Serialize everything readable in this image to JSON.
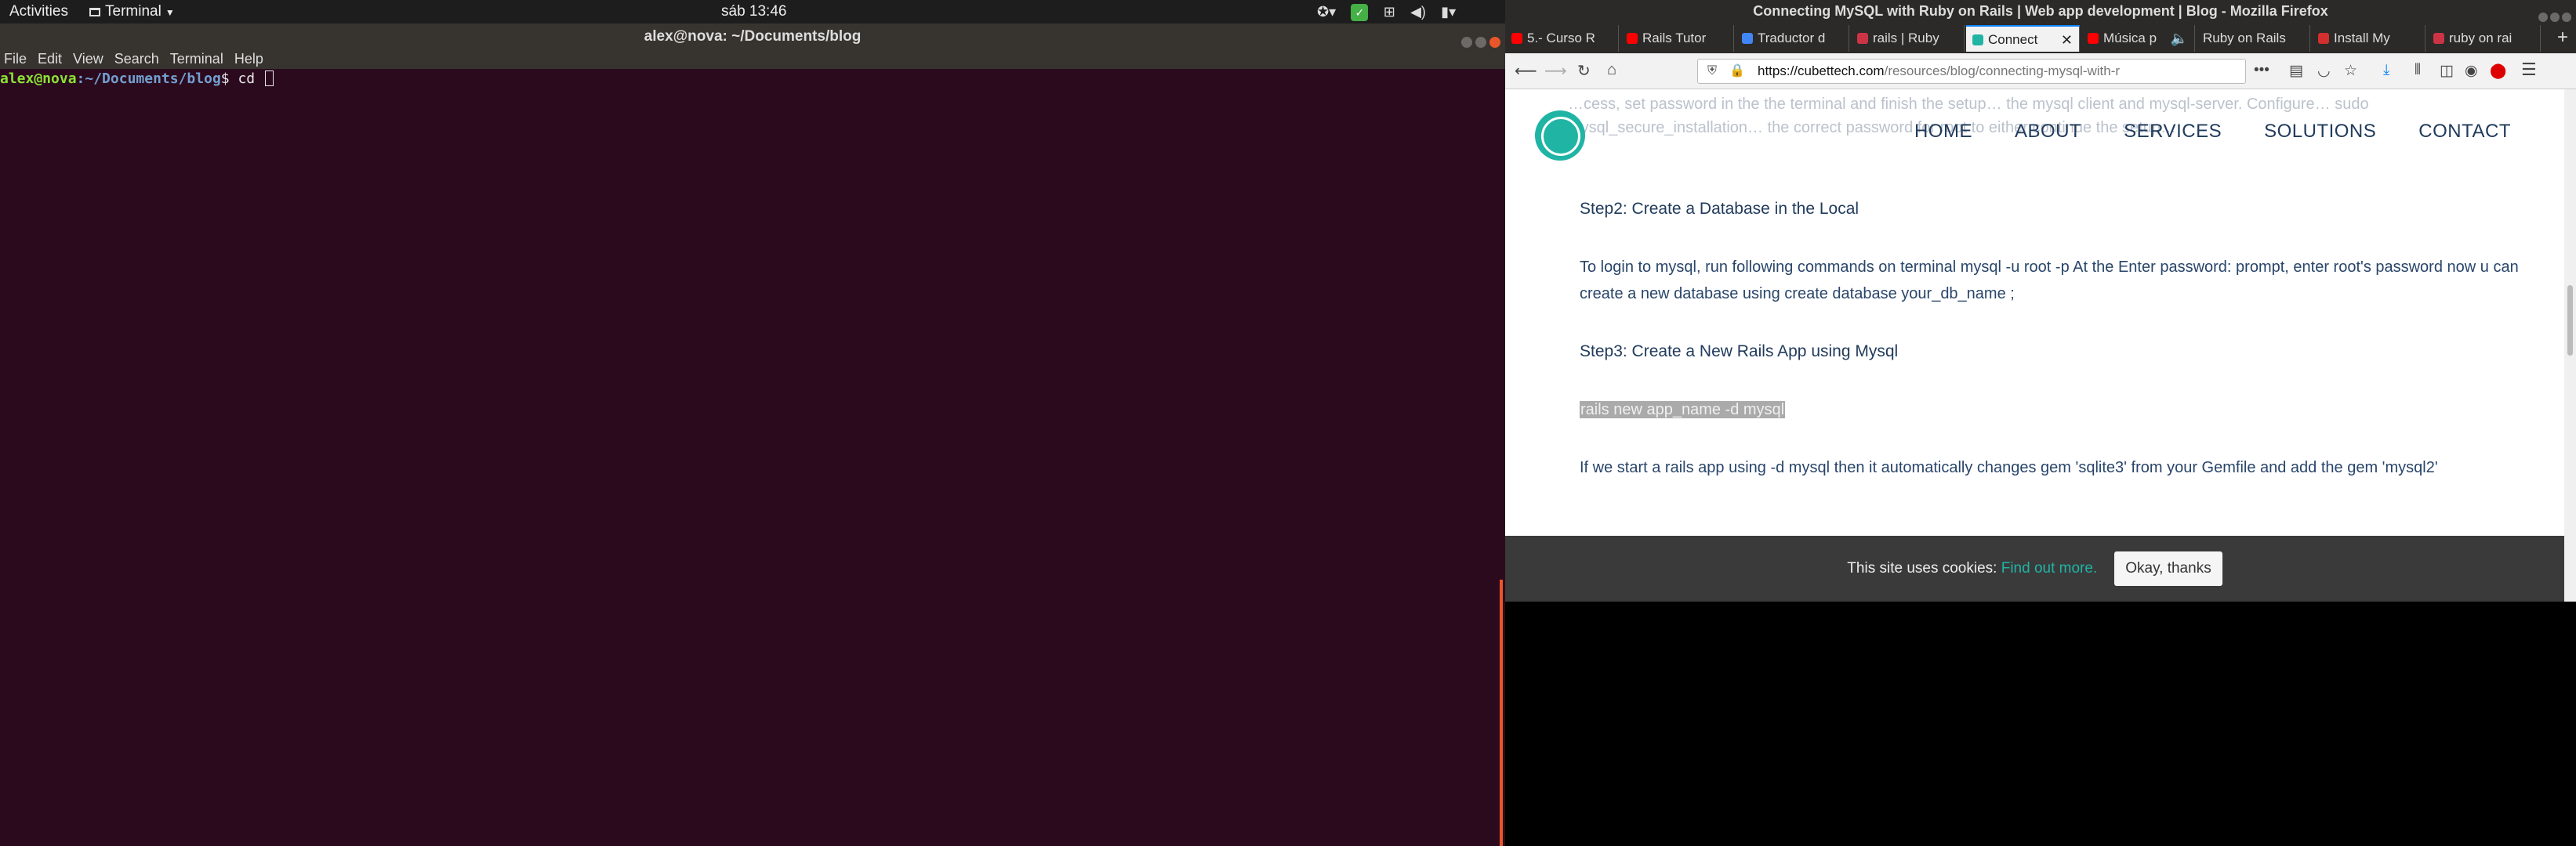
{
  "topbar": {
    "activities": "Activities",
    "app_menu": "Terminal",
    "clock": "sáb 13:46"
  },
  "terminal": {
    "title": "alex@nova: ~/Documents/blog",
    "menu": [
      "File",
      "Edit",
      "View",
      "Search",
      "Terminal",
      "Help"
    ],
    "prompt_user": "alex@nova",
    "prompt_path": ":~/Documents/blog",
    "prompt_suffix": "$ ",
    "command": "cd "
  },
  "firefox": {
    "window_title": "Connecting MySQL with Ruby on Rails | Web app development | Blog - Mozilla Firefox",
    "tabs": [
      {
        "label": "5.- Curso R",
        "favicon_color": "#ff0000"
      },
      {
        "label": "Rails Tutor",
        "favicon_color": "#ff0000"
      },
      {
        "label": "Traductor d",
        "favicon_color": "#4285f4"
      },
      {
        "label": "rails | Ruby",
        "favicon_color": "#cc3344"
      },
      {
        "label": "Connect",
        "favicon_color": "#20b4a5",
        "active": true
      },
      {
        "label": "Música p",
        "favicon_color": "#ff0000"
      },
      {
        "label": "Ruby on Rails",
        "favicon_color": "#777777"
      },
      {
        "label": "Install My",
        "favicon_color": "#d32f2f"
      },
      {
        "label": "ruby on rai",
        "favicon_color": "#cc3344"
      }
    ],
    "url_host": "https://cubettech.com",
    "url_path": "/resources/blog/connecting-mysql-with-r"
  },
  "site": {
    "faded_text": "…cess, set password in the the terminal and finish the setup… the mysql client and mysql-server. Configure… sudo mysql_secure_installation… the correct password for root to either continue the setup…",
    "nav": [
      "HOME",
      "ABOUT",
      "SERVICES",
      "SOLUTIONS",
      "CONTACT"
    ],
    "step2_heading": "Step2: Create a Database in the Local",
    "step2_text": "To login to mysql, run following commands on terminal mysql -u root -p At the Enter password: prompt, enter root's password now u can create a new database using create database your_db_name ;",
    "step3_heading": "Step3: Create a New Rails App using Mysql",
    "command": "rails new app_name -d mysql",
    "after_text": "If we start a rails app using -d mysql then it automatically changes gem 'sqlite3' from your Gemfile and add the gem 'mysql2'",
    "cookie_text": "This site uses cookies: ",
    "cookie_link": "Find out more.",
    "cookie_button": "Okay, thanks"
  },
  "colors": {
    "terminal_bg": "#2c0a1e",
    "accent_teal": "#20b4a5",
    "ubuntu_orange": "#e9562a",
    "heading_navy": "#213b5c"
  }
}
